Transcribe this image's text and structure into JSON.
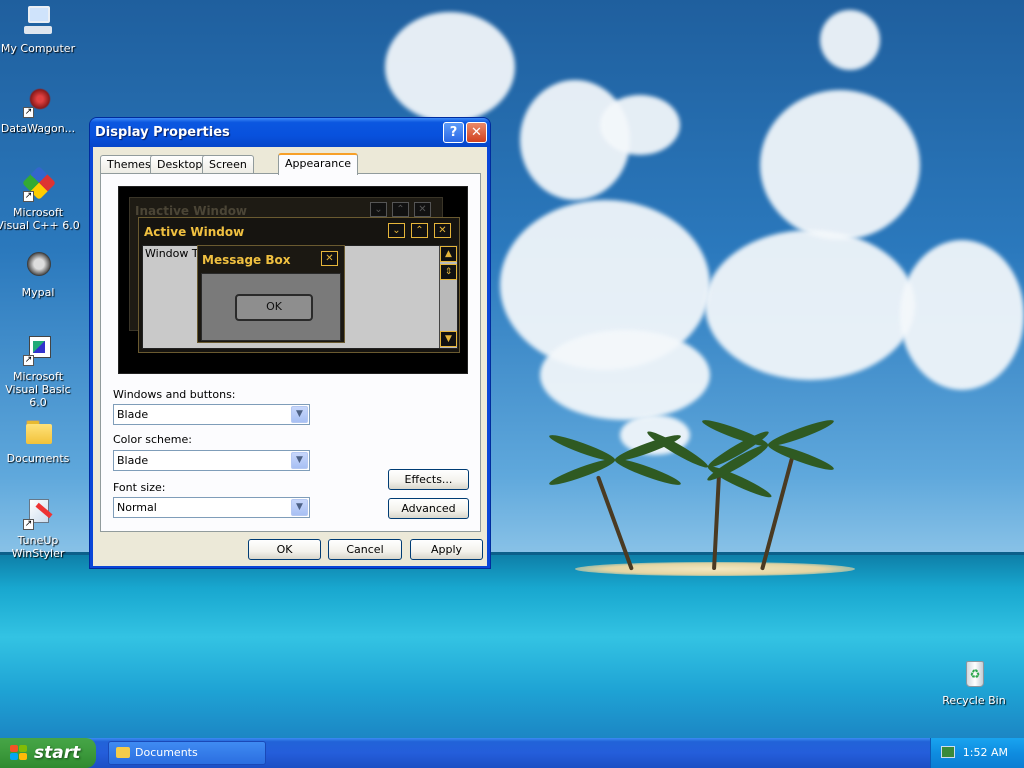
{
  "desktop": {
    "icons": [
      {
        "name": "My Computer"
      },
      {
        "name": "DataWagon..."
      },
      {
        "name": "Microsoft Visual C++ 6.0"
      },
      {
        "name": "Mypal"
      },
      {
        "name": "Microsoft Visual Basic 6.0"
      },
      {
        "name": "Documents"
      },
      {
        "name": "TuneUp WinStyler"
      },
      {
        "name": "Recycle Bin"
      }
    ]
  },
  "window": {
    "title": "Display Properties",
    "help_glyph": "?",
    "close_glyph": "✕",
    "tabs": [
      {
        "label": "Themes"
      },
      {
        "label": "Desktop"
      },
      {
        "label": "Screen Saver"
      },
      {
        "label": "Appearance"
      }
    ],
    "active_tab": "Appearance",
    "preview": {
      "inactive_title": "Inactive Window",
      "active_title": "Active Window",
      "window_text": "Window Text",
      "message_title": "Message Box",
      "ok_label": "OK"
    },
    "windows_buttons_label": "Windows and buttons:",
    "windows_buttons_value": "Blade",
    "color_scheme_label": "Color scheme:",
    "color_scheme_value": "Blade",
    "font_size_label": "Font size:",
    "font_size_value": "Normal",
    "effects_label": "Effects...",
    "advanced_label": "Advanced",
    "ok_label": "OK",
    "cancel_label": "Cancel",
    "apply_label": "Apply"
  },
  "taskbar": {
    "start_label": "start",
    "task_label": "Documents",
    "clock": "1:52 AM"
  },
  "colors": {
    "xp_blue": "#0a46d8",
    "blade_gold": "#f0c040",
    "start_green": "#3c9a3c"
  }
}
